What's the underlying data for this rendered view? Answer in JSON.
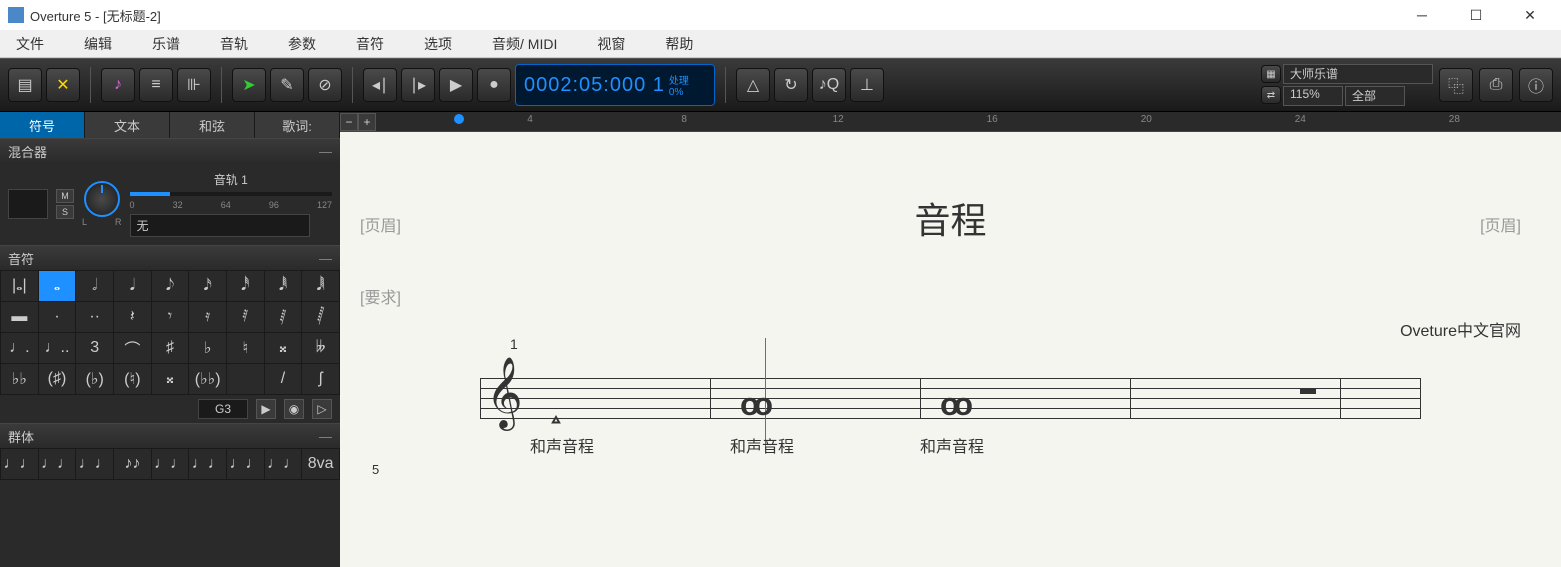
{
  "titlebar": {
    "app_title": "Overture 5 - [无标题-2]"
  },
  "menu": {
    "file": "文件",
    "edit": "编辑",
    "score": "乐谱",
    "track": "音轨",
    "params": "参数",
    "notes": "音符",
    "options": "选项",
    "audio_midi": "音频/ MIDI",
    "window": "视窗",
    "help": "帮助"
  },
  "transport": {
    "timecode": "0002:05:000  1",
    "status_label": "处理",
    "status_pct": "0%"
  },
  "toolbar_right": {
    "template_label": "大师乐谱",
    "zoom": "115%",
    "filter": "全部"
  },
  "tabs": {
    "symbols": "符号",
    "text": "文本",
    "chords": "和弦",
    "lyrics": "歌词:"
  },
  "mixer": {
    "header": "混合器",
    "track_label": "音轨 1",
    "m_btn": "M",
    "s_btn": "S",
    "l_label": "L",
    "r_label": "R",
    "vol_marks": [
      "0",
      "32",
      "64",
      "96",
      "127"
    ],
    "instrument": "无"
  },
  "notes_panel": {
    "header": "音符",
    "note_input": "G3",
    "grid_labels": [
      "|𝅝|",
      "𝅝",
      "𝅗𝅥",
      "𝅘𝅥",
      "𝅘𝅥𝅮",
      "𝅘𝅥𝅯",
      "𝅘𝅥𝅰",
      "𝅘𝅥𝅱",
      "𝅘𝅥𝅲",
      "▬",
      "·",
      "··",
      "𝄽",
      "𝄾",
      "𝄿",
      "𝅀",
      "𝅁",
      "𝅂",
      "♩.",
      "♩..",
      "3",
      "⌒",
      "♯",
      "♭",
      "♮",
      "𝄪",
      "𝄫",
      "♭♭",
      "(♯)",
      "(♭)",
      "(♮)",
      "𝄪",
      "(♭♭)",
      "",
      "/",
      "ʃ"
    ]
  },
  "groups_panel": {
    "header": "群体",
    "items": [
      "♩♩",
      "♩♩",
      "♩♩",
      "♪♪",
      "♩♩",
      "♩♩",
      "♩♩",
      "♩♩",
      "8va"
    ]
  },
  "ruler": {
    "marks": [
      "4",
      "8",
      "12",
      "16",
      "20",
      "24",
      "28"
    ]
  },
  "score": {
    "header_left": "[页眉]",
    "header_right": "[页眉]",
    "title": "音程",
    "requirement": "[要求]",
    "composer": "Oveture中文官网",
    "measure_1": "1",
    "system_5": "5",
    "lyric1": "和声音程",
    "lyric2": "和声音程",
    "lyric3": "和声音程"
  }
}
